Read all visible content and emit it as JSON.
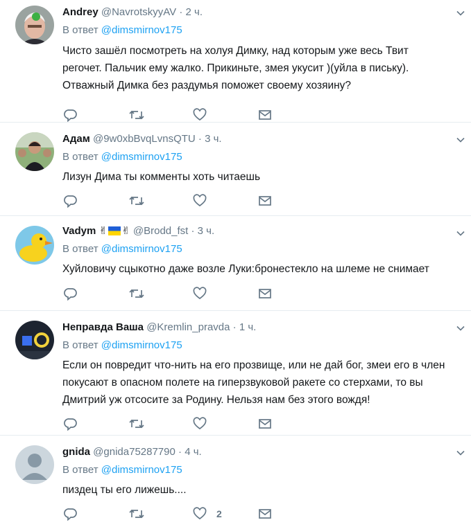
{
  "reply_prefix": "В ответ",
  "reply_mention": "@dimsmirnov175",
  "tweets": [
    {
      "name": "Andrey",
      "handle": "@NavrotskyyAV",
      "time": "2 ч.",
      "text": "Чисто зашёл посмотреть на холуя Димку, над которым уже весь Твит регочет. Пальчик ему жалко. Прикиньте, змея укусит )(уйла в письку). Отважный Димка без раздумья поможет своему хозяину?",
      "likes": ""
    },
    {
      "name": "Адам",
      "handle": "@9w0xbBvqLvnsQTU",
      "time": "3 ч.",
      "text": "Лизун Дима ты комменты хоть читаешь",
      "likes": ""
    },
    {
      "name": "Vadym",
      "handle": "@Brodd_fst",
      "time": "3 ч.",
      "text": "Хуйловичу сцыкотно даже возле Луки:бронестекло на шлеме не снимает",
      "likes": "",
      "name_emoji": "✌"
    },
    {
      "name": "Неправда Ваша",
      "handle": "@Kremlin_pravda",
      "time": "1 ч.",
      "text": "Если он повредит что-нить на его прозвище, или не дай бог, змеи его в член покусают в опасном полете на гиперзвуковой ракете со стерхами, то вы Дмитрий уж отсосите за Родину. Нельзя нам без этого вождя!",
      "likes": ""
    },
    {
      "name": "gnida",
      "handle": "@gnida75287790",
      "time": "4 ч.",
      "text": "пиздец ты его лижешь....",
      "likes": "2"
    }
  ],
  "icons": {
    "reply": "reply-icon",
    "retweet": "retweet-icon",
    "like": "heart-icon",
    "dm": "envelope-icon",
    "caret": "chevron-down-icon"
  },
  "colors": {
    "icon": "#657786",
    "mention": "#1da1f2",
    "divider": "#e6ecf0"
  }
}
